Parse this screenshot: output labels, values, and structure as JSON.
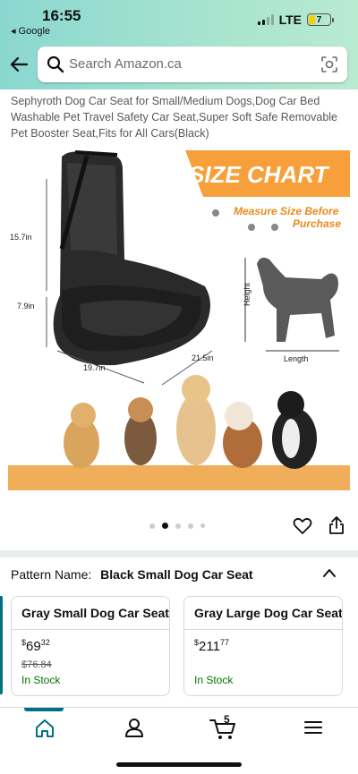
{
  "status_bar": {
    "time": "16:55",
    "back_app": "◂ Google",
    "network": "LTE",
    "battery": "7"
  },
  "search": {
    "placeholder": "Search Amazon.ca"
  },
  "product": {
    "title": "Sephyroth Dog Car Seat for Small/Medium Dogs,Dog Car Bed Washable Pet Travel Safety Car Seat,Super Soft Safe Removable Pet Booster Seat,Fits for All Cars(Black)"
  },
  "image": {
    "size_chart_label": "SIZE CHART",
    "measure_note_line1": "Measure Size Before",
    "measure_note_line2": "Purchase",
    "dim_height": "15.7in",
    "dim_seat_height": "7.9in",
    "dim_width": "19.7in",
    "dim_depth": "21.5in",
    "dog_height_label": "Height",
    "dog_length_label": "Length"
  },
  "carousel": {
    "image_count": 5,
    "active_index": 1
  },
  "pattern": {
    "label": "Pattern Name:",
    "value": "Black Small Dog Car Seat"
  },
  "options": [
    {
      "name": "Gray Small Dog Car Seat",
      "currency": "$",
      "whole": "69",
      "fraction": "32",
      "list_price": "$76.84",
      "availability": "In Stock"
    },
    {
      "name": "Gray Large Dog Car Seat",
      "currency": "$",
      "whole": "211",
      "fraction": "77",
      "availability": "In Stock"
    }
  ],
  "nav": {
    "cart_count": "5"
  },
  "colors": {
    "accent": "#007185",
    "in_stock": "#007600",
    "orange_banner": "#f7a03b",
    "header_teal": "#8ad7d0"
  }
}
